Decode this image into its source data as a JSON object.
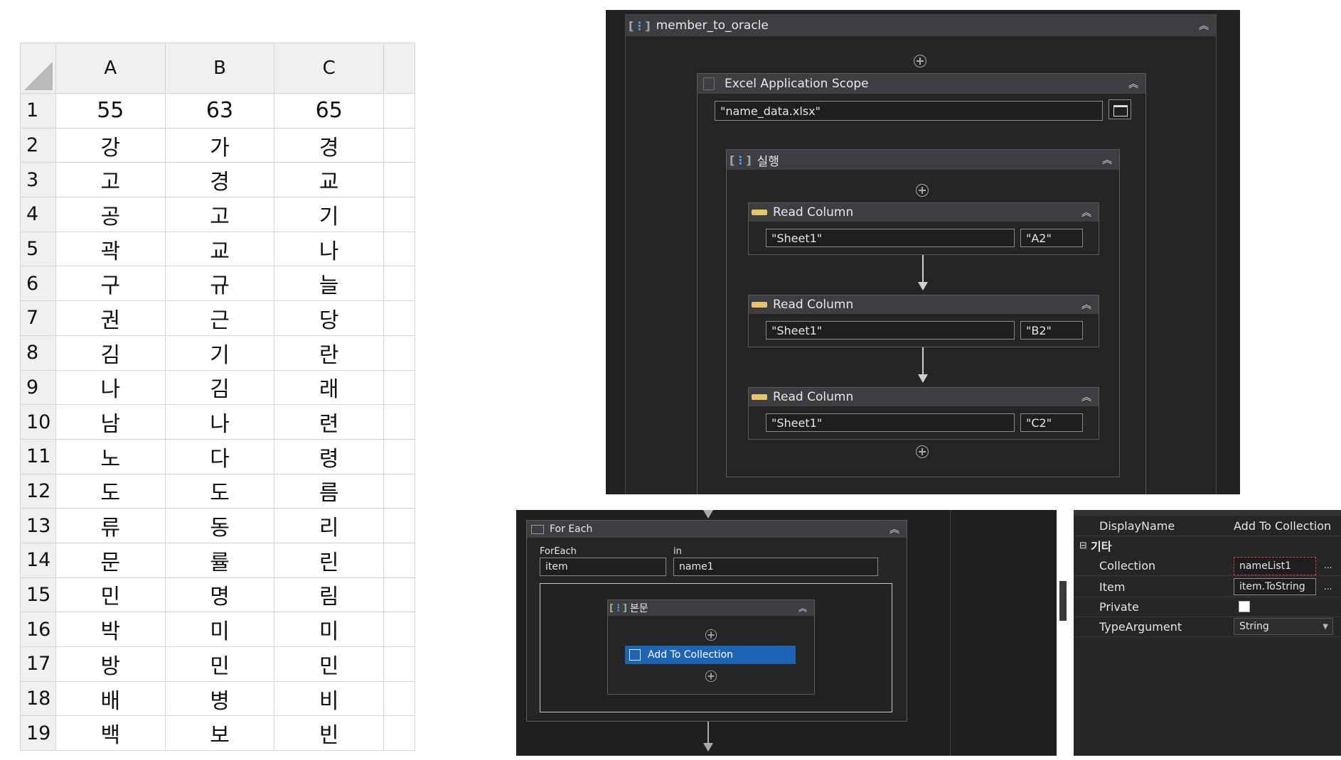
{
  "sheet": {
    "columns": [
      "A",
      "B",
      "C"
    ],
    "rows": [
      {
        "n": "1",
        "a": "55",
        "b": "63",
        "c": "65"
      },
      {
        "n": "2",
        "a": "강",
        "b": "가",
        "c": "경"
      },
      {
        "n": "3",
        "a": "고",
        "b": "경",
        "c": "교"
      },
      {
        "n": "4",
        "a": "공",
        "b": "고",
        "c": "기"
      },
      {
        "n": "5",
        "a": "곽",
        "b": "교",
        "c": "나"
      },
      {
        "n": "6",
        "a": "구",
        "b": "규",
        "c": "늘"
      },
      {
        "n": "7",
        "a": "권",
        "b": "근",
        "c": "당"
      },
      {
        "n": "8",
        "a": "김",
        "b": "기",
        "c": "란"
      },
      {
        "n": "9",
        "a": "나",
        "b": "김",
        "c": "래"
      },
      {
        "n": "10",
        "a": "남",
        "b": "나",
        "c": "련"
      },
      {
        "n": "11",
        "a": "노",
        "b": "다",
        "c": "령"
      },
      {
        "n": "12",
        "a": "도",
        "b": "도",
        "c": "름"
      },
      {
        "n": "13",
        "a": "류",
        "b": "동",
        "c": "리"
      },
      {
        "n": "14",
        "a": "문",
        "b": "률",
        "c": "린"
      },
      {
        "n": "15",
        "a": "민",
        "b": "명",
        "c": "림"
      },
      {
        "n": "16",
        "a": "박",
        "b": "미",
        "c": "미"
      },
      {
        "n": "17",
        "a": "방",
        "b": "민",
        "c": "민"
      },
      {
        "n": "18",
        "a": "배",
        "b": "병",
        "c": "비"
      },
      {
        "n": "19",
        "a": "백",
        "b": "보",
        "c": "빈"
      }
    ]
  },
  "workflow": {
    "sequence_title": "member_to_oracle",
    "excel_scope_title": "Excel Application Scope",
    "excel_file": "\"name_data.xlsx\"",
    "inner_sequence_title": "실행",
    "read_columns": [
      {
        "title": "Read Column",
        "sheet": "\"Sheet1\"",
        "cell": "\"A2\""
      },
      {
        "title": "Read Column",
        "sheet": "\"Sheet1\"",
        "cell": "\"B2\""
      },
      {
        "title": "Read Column",
        "sheet": "\"Sheet1\"",
        "cell": "\"C2\""
      }
    ]
  },
  "foreach": {
    "title": "For Each",
    "foreach_label": "ForEach",
    "item_value": "item",
    "in_label": "in",
    "collection_value": "name1",
    "body_title": "본문",
    "activity_label": "Add To Collection"
  },
  "properties": {
    "displayname_key": "DisplayName",
    "displayname_value": "Add To Collection",
    "section_label": "기타",
    "collection_key": "Collection",
    "collection_value": "nameList1",
    "item_key": "Item",
    "item_value": "item.ToString",
    "private_key": "Private",
    "typeargument_key": "TypeArgument",
    "typeargument_value": "String",
    "ellipsis": "..."
  },
  "colors": {
    "panel_bg": "#202020",
    "header_bg": "#3e3e42",
    "selected_activity": "#1e64b4",
    "highlight_border": "#e03a3a"
  }
}
